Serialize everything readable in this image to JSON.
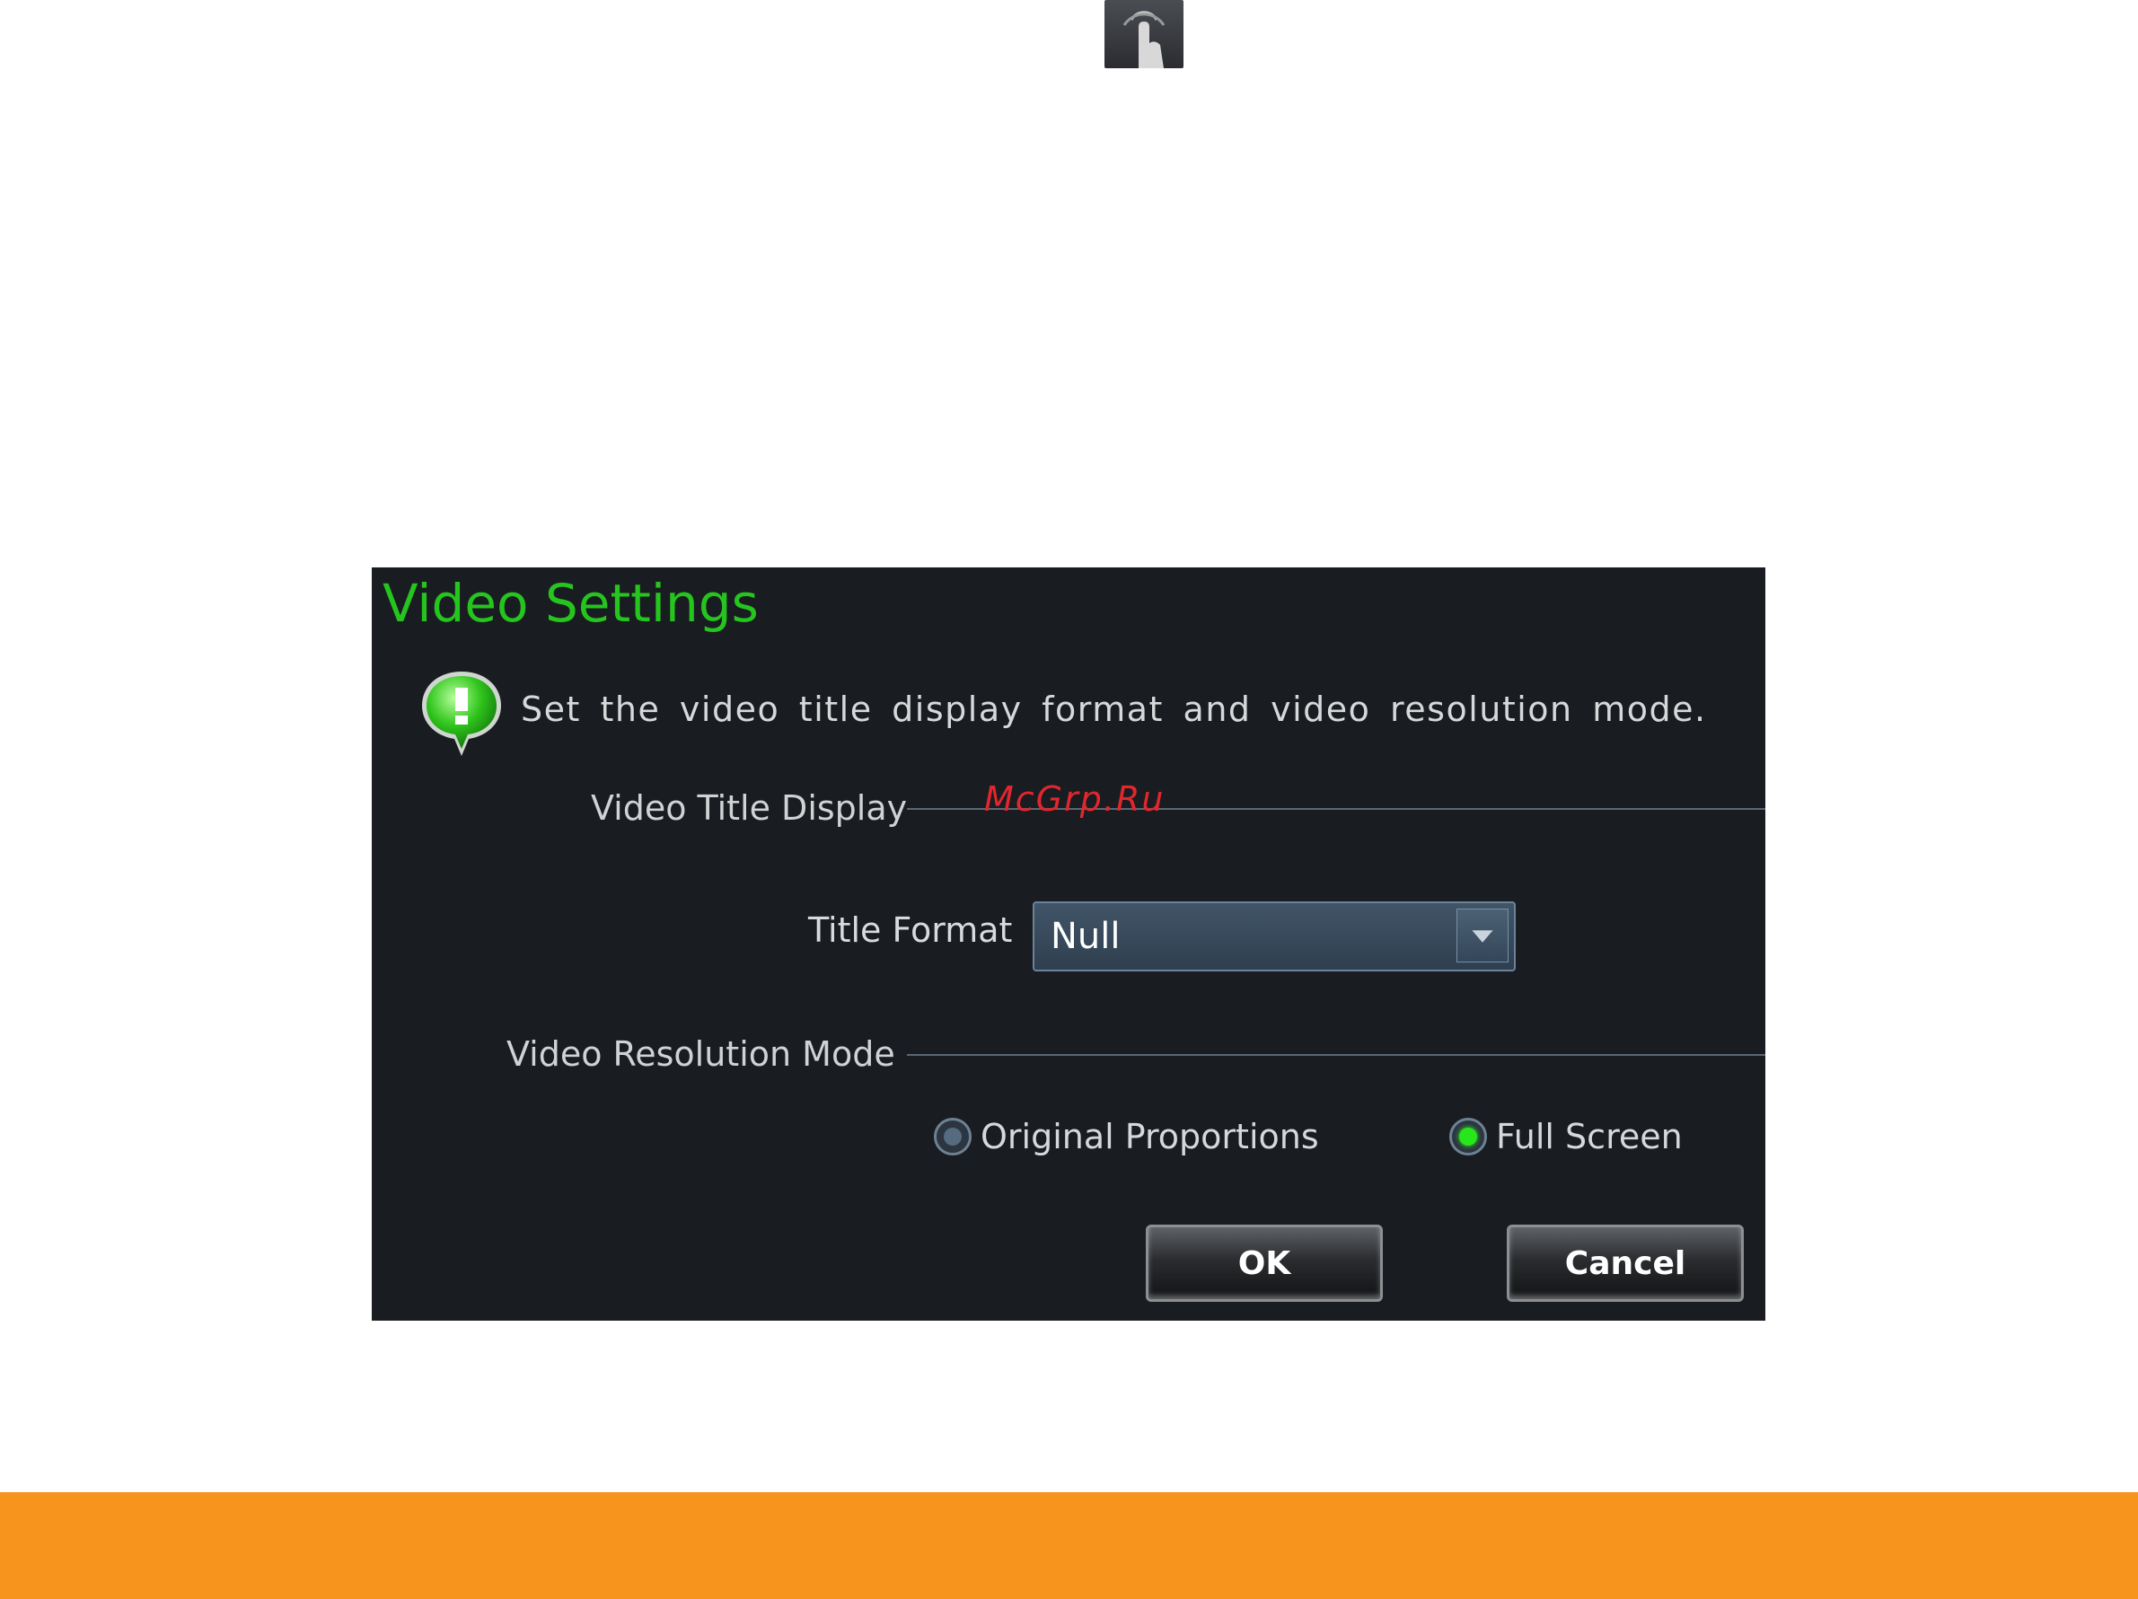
{
  "dialog": {
    "title": "Video Settings",
    "info_text": "Set the video title display format and video resolution mode.",
    "section_title_display": "Video Title Display",
    "title_format_label": "Title Format",
    "title_format_value": "Null",
    "section_resolution_mode": "Video Resolution Mode",
    "radio_original": "Original Proportions",
    "radio_fullscreen": "Full Screen",
    "selected_mode": "Full Screen",
    "ok_label": "OK",
    "cancel_label": "Cancel"
  },
  "watermark": "McGrp.Ru",
  "icons": [
    "touch-tap-icon",
    "info-bubble-icon",
    "dropdown-arrow-icon"
  ],
  "colors": {
    "title": "#26c41e",
    "dialog_bg": "#191c20",
    "footer": "#f7941d",
    "radio_on": "#27e61a",
    "watermark": "#e0272e"
  }
}
